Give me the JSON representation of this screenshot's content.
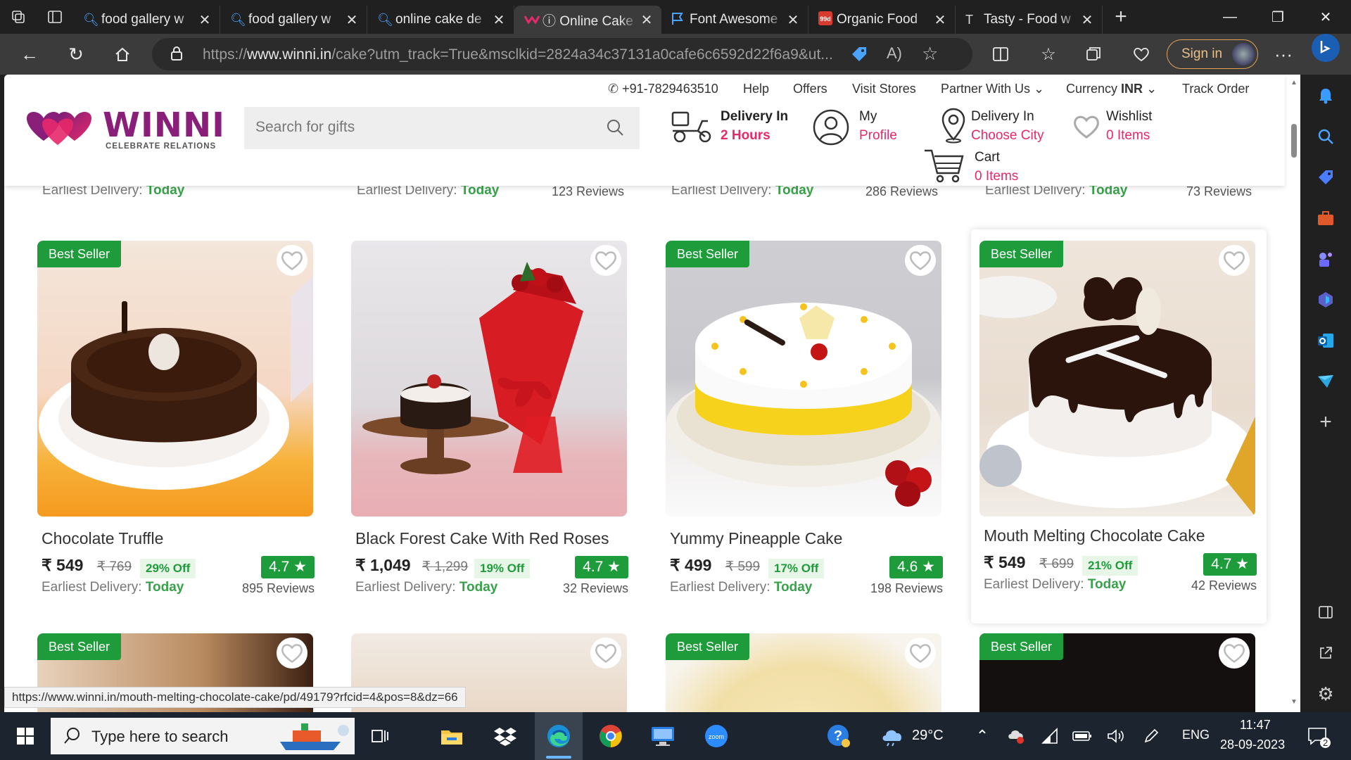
{
  "browser": {
    "tabs": [
      {
        "title": "food gallery w",
        "icon": "search-icon",
        "active": false
      },
      {
        "title": "food gallery w",
        "icon": "search-icon",
        "active": false
      },
      {
        "title": "online cake de",
        "icon": "search-icon",
        "active": false
      },
      {
        "title": "ⓘ Online Cake",
        "icon": "winni-favicon",
        "active": true
      },
      {
        "title": "Font Awesome",
        "icon": "flag-icon",
        "active": false
      },
      {
        "title": "Organic Food",
        "icon": "brand-favicon",
        "active": false
      },
      {
        "title": "Tasty - Food w",
        "icon": "t-favicon",
        "active": false
      }
    ],
    "url_prefix": "https://",
    "url_domain": "www.winni.in",
    "url_rest": "/cake?utm_track=True&msclkid=2824a34c37131a0cafe6c6592d22f6a9&ut...",
    "sign_in": "Sign in"
  },
  "site": {
    "toplinks": {
      "phone": "+91-7829463510",
      "help": "Help",
      "offers": "Offers",
      "stores": "Visit Stores",
      "partner": "Partner With Us",
      "currency_label": "Currency",
      "currency_value": "INR",
      "track": "Track Order"
    },
    "logo_word": "WINNI",
    "logo_tagline": "CELEBRATE RELATIONS",
    "search_placeholder": "Search for gifts",
    "header": {
      "delivery_line1": "Delivery In",
      "delivery_line2": "2 Hours",
      "profile_line1": "My",
      "profile_line2": "Profile",
      "city_line1": "Delivery In",
      "city_line2": "Choose City",
      "wishlist_line1": "Wishlist",
      "wishlist_line2": "0 Items",
      "cart_line1": "Cart",
      "cart_line2": "0 Items"
    },
    "peek_row": [
      {
        "earliest_label": "Earliest Delivery:",
        "earliest_value": "Today",
        "reviews": ""
      },
      {
        "earliest_label": "Earliest Delivery:",
        "earliest_value": "Today",
        "reviews": "123 Reviews"
      },
      {
        "earliest_label": "Earliest Delivery:",
        "earliest_value": "Today",
        "reviews": "286 Reviews"
      },
      {
        "earliest_label": "Earliest Delivery:",
        "earliest_value": "Today",
        "reviews": "73 Reviews"
      }
    ],
    "products": [
      {
        "badge": "Best Seller",
        "name": "Chocolate Truffle",
        "price": "₹ 549",
        "mrp": "₹ 769",
        "off": "29% Off",
        "rating": "4.7 ★",
        "earliest_label": "Earliest Delivery:",
        "earliest_value": "Today",
        "reviews": "895 Reviews"
      },
      {
        "badge": "",
        "name": "Black Forest Cake With Red Roses",
        "price": "₹ 1,049",
        "mrp": "₹ 1,299",
        "off": "19% Off",
        "rating": "4.7 ★",
        "earliest_label": "Earliest Delivery:",
        "earliest_value": "Today",
        "reviews": "32 Reviews"
      },
      {
        "badge": "Best Seller",
        "name": "Yummy Pineapple Cake",
        "price": "₹ 499",
        "mrp": "₹ 599",
        "off": "17% Off",
        "rating": "4.6 ★",
        "earliest_label": "Earliest Delivery:",
        "earliest_value": "Today",
        "reviews": "198 Reviews"
      },
      {
        "badge": "Best Seller",
        "name": "Mouth Melting Chocolate Cake",
        "price": "₹ 549",
        "mrp": "₹ 699",
        "off": "21% Off",
        "rating": "4.7 ★",
        "earliest_label": "Earliest Delivery:",
        "earliest_value": "Today",
        "reviews": "42 Reviews"
      }
    ],
    "next_row_badges": [
      "Best Seller",
      "",
      "Best Seller",
      "Best Seller"
    ],
    "status_url": "https://www.winni.in/mouth-melting-chocolate-cake/pd/49179?rfcid=4&pos=8&dz=66"
  },
  "taskbar": {
    "search_placeholder": "Type here to search",
    "temperature": "29°C",
    "language": "ENG",
    "time": "11:47",
    "date": "28-09-2023",
    "notification_count": "2"
  },
  "colors": {
    "accent_pink": "#e7286a",
    "green": "#1e9b3a",
    "logo_purple": "#8a1f7a"
  }
}
